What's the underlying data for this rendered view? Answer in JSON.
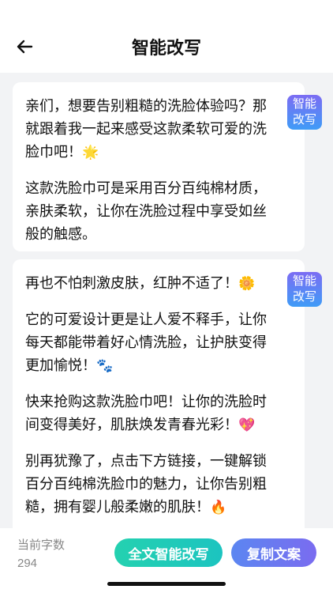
{
  "header": {
    "title": "智能改写",
    "back_icon": "arrow-left-icon"
  },
  "cards": [
    {
      "badge": "智能改写",
      "paragraphs": [
        {
          "text": "亲们，想要告别粗糙的洗脸体验吗？那就跟着我一起来感受这款柔软可爱的洗脸巾吧！",
          "emoji": "🌟"
        },
        {
          "text": "这款洗脸巾可是采用百分百纯棉材质，亲肤柔软，让你在洗脸过程中享受如丝般的触感。",
          "emoji": ""
        }
      ]
    },
    {
      "badge": "智能改写",
      "paragraphs": [
        {
          "text": "再也不怕刺激皮肤，红肿不适了！",
          "emoji": "🌼"
        },
        {
          "text": "它的可爱设计更是让人爱不释手，让你每天都能带着好心情洗脸，让护肤变得更加愉悦！",
          "emoji": "🐾"
        },
        {
          "text": "快来抢购这款洗脸巾吧！让你的洗脸时间变得美好，肌肤焕发青春光彩！",
          "emoji": "💖"
        },
        {
          "text": "别再犹豫了，点击下方链接，一键解锁百分百纯棉洗脸巾的魅力，让你告别粗糙，拥有婴儿般柔嫩的肌肤！",
          "emoji": "🔥"
        }
      ]
    }
  ],
  "footer": {
    "count_label": "当前字数",
    "count_value": "294",
    "rewrite_all_label": "全文智能改写",
    "copy_label": "复制文案"
  },
  "colors": {
    "badge_gradient": [
      "#7c6cf3",
      "#3f9cf7"
    ],
    "rewrite_button": "#24d1b0",
    "copy_button": "#6a79f0",
    "background": "#f2f3f5"
  }
}
